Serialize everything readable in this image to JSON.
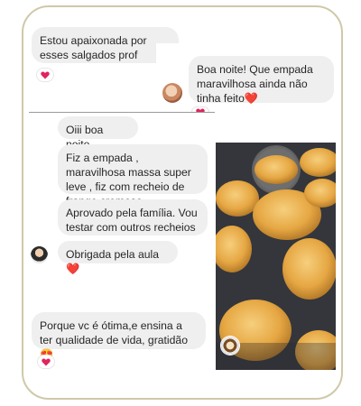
{
  "messages": {
    "m1": "Estou apaixonada por esses salgados prof",
    "m2": "Boa noite! Que empada maravilhosa ainda não tinha feito❤️",
    "m3": "Oiii boa noite",
    "m4": "Fiz a empada , maravilhosa massa super leve , fiz com recheio de frango cremoso",
    "m5": "Aprovado pela família. Vou testar com outros recheios",
    "m6": "Obrigada pela aula ❤️",
    "m7": "Porque vc é ótima,e ensina a ter qualidade de vida, gratidão 😍"
  },
  "colors": {
    "heart": "#e0245e",
    "bubble": "#efefef",
    "frame": "#cfc9a8"
  },
  "icons": [
    "heart-icon",
    "avatar",
    "photo-avatar-icon"
  ]
}
